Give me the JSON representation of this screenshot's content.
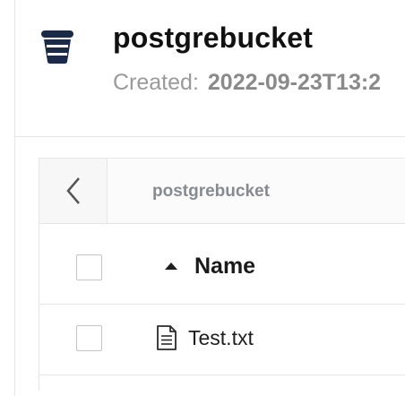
{
  "bucket": {
    "name": "postgrebucket",
    "created_label": "Created:",
    "created_value": "2022-09-23T13:2",
    "icon": "bucket-icon"
  },
  "browser": {
    "back_icon": "chevron-left-icon",
    "breadcrumb": "postgrebucket",
    "columns": {
      "name_label": "Name",
      "sort_icon": "sort-ascending-icon"
    },
    "files": [
      {
        "name": "Test.txt",
        "icon": "text-file-icon"
      }
    ]
  },
  "colors": {
    "icon_navy": "#1c2a4a",
    "border": "#e4e6ea",
    "muted_text": "#858b91"
  }
}
